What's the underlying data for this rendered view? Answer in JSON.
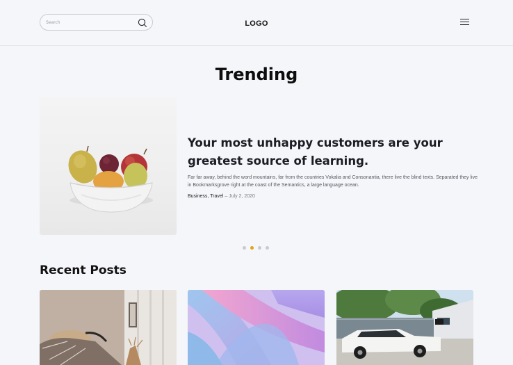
{
  "header": {
    "search_placeholder": "Search",
    "logo": "LOGO",
    "search_icon": "search-icon",
    "menu_icon": "hamburger-menu-icon"
  },
  "trending": {
    "title": "Trending",
    "headline": "Your most unhappy customers are your greatest source of learning.",
    "excerpt": "Far far away, behind the word mountains, far from the countries Vokalia and Consonantia, there live the blind texts. Separated they live in Bookmarksgrove right at the coast of the Semantics, a large language ocean.",
    "categories": "Business, Travel",
    "separator": " – ",
    "date": "July 2, 2020",
    "slides_total": 4,
    "active_slide": 2
  },
  "recent": {
    "title": "Recent Posts"
  },
  "colors": {
    "background": "#f5f6fa",
    "accent_dot": "#e3a21a",
    "inactive_dot": "#c9cad1"
  }
}
